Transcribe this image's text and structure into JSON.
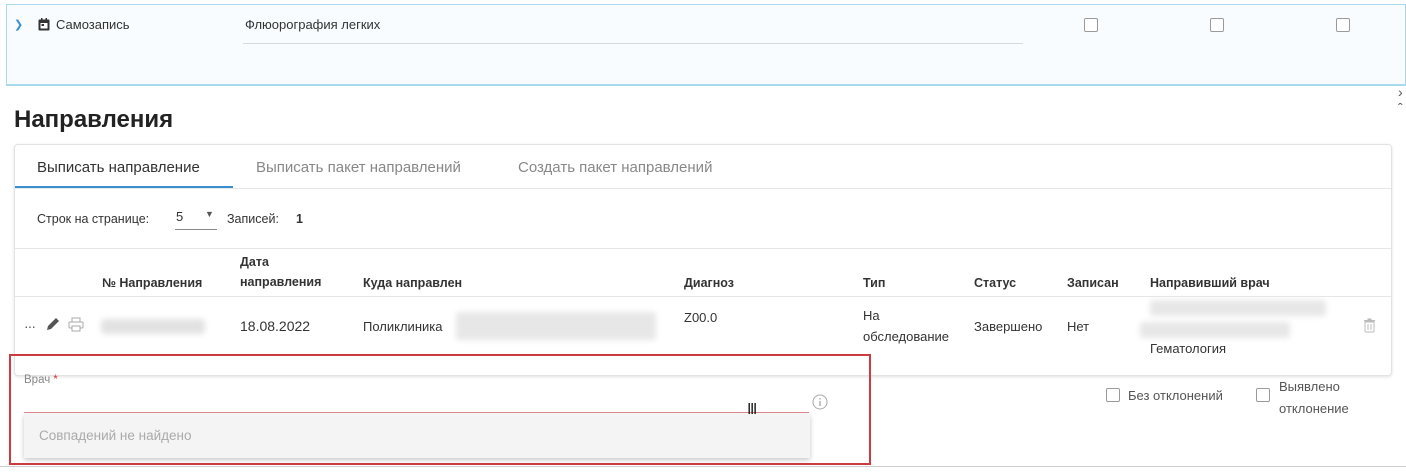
{
  "exam_row": {
    "source": "Самозапись",
    "exam": "Флюорография легких",
    "checkbox_count": 3
  },
  "section_title": "Направления",
  "tabs": [
    {
      "label": "Выписать направление",
      "active": true
    },
    {
      "label": "Выписать пакет направлений",
      "active": false
    },
    {
      "label": "Создать пакет направлений",
      "active": false
    }
  ],
  "pager": {
    "rows_label": "Строк на странице:",
    "rows_value": "5",
    "records_label": "Записей:",
    "records_value": "1"
  },
  "table": {
    "headers": {
      "num": "№ Направления",
      "date": "Дата направления",
      "dest": "Куда направлен",
      "diag": "Диагноз",
      "type": "Тип",
      "status": "Статус",
      "booked": "Записан",
      "doctor": "Направивший врач"
    },
    "row": {
      "date": "18.08.2022",
      "dest": "Поликлиника",
      "diag": "Z00.0",
      "type": "На обследование",
      "status": "Завершено",
      "booked": "Нет",
      "dept": "Гематология"
    }
  },
  "doctor_field": {
    "label": "Врач",
    "required_mark": "*",
    "value": "",
    "no_match_text": "Совпадений не найдено"
  },
  "options": {
    "no_deviation": "Без отклонений",
    "deviation_found": "Выявлено отклонение"
  },
  "colors": {
    "accent": "#3a8fd0",
    "error_border": "#cc3b40",
    "panel_border": "#a9d9ec"
  }
}
